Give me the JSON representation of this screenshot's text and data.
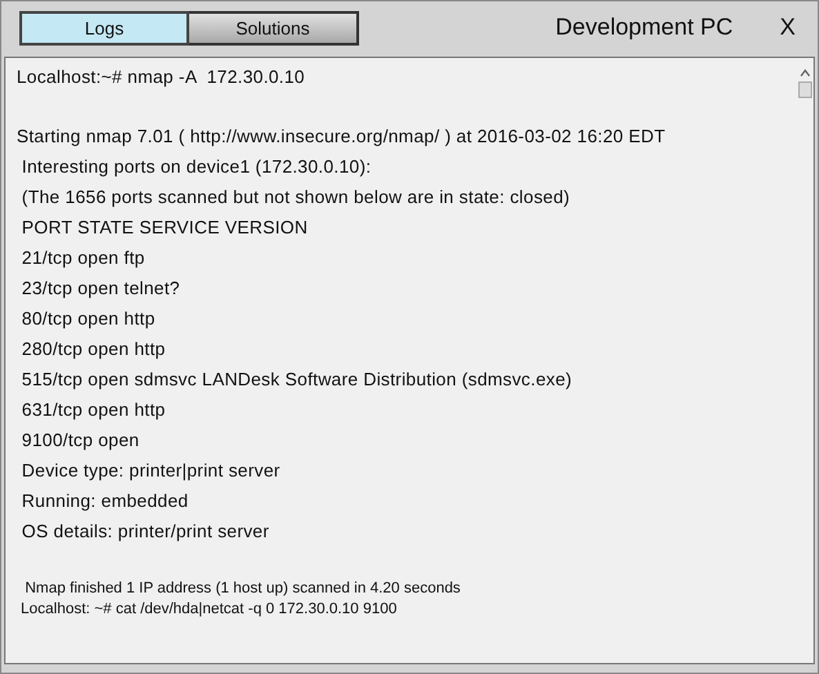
{
  "tabs": [
    {
      "label": "Logs",
      "selected": true
    },
    {
      "label": "Solutions",
      "selected": false
    }
  ],
  "window": {
    "title": "Development PC",
    "close": "X"
  },
  "terminal": {
    "command": "Localhost:~# nmap -A  172.30.0.10",
    "lines": [
      "Starting nmap 7.01 ( http://www.insecure.org/nmap/ ) at 2016-03-02 16:20 EDT",
      " Interesting ports on device1 (172.30.0.10):",
      " (The 1656 ports scanned but not shown below are in state: closed)",
      " PORT STATE SERVICE VERSION",
      " 21/tcp open ftp",
      " 23/tcp open telnet?",
      " 80/tcp open http",
      " 280/tcp open http",
      " 515/tcp open sdmsvc LANDesk Software Distribution (sdmsvc.exe)",
      " 631/tcp open http",
      " 9100/tcp open",
      " Device type: printer|print server",
      " Running: embedded",
      " OS details: printer/print server"
    ],
    "footer": [
      "  Nmap finished 1 IP address (1 host up) scanned in 4.20 seconds",
      " Localhost: ~# cat /dev/hda|netcat -q 0 172.30.0.10 9100"
    ]
  }
}
